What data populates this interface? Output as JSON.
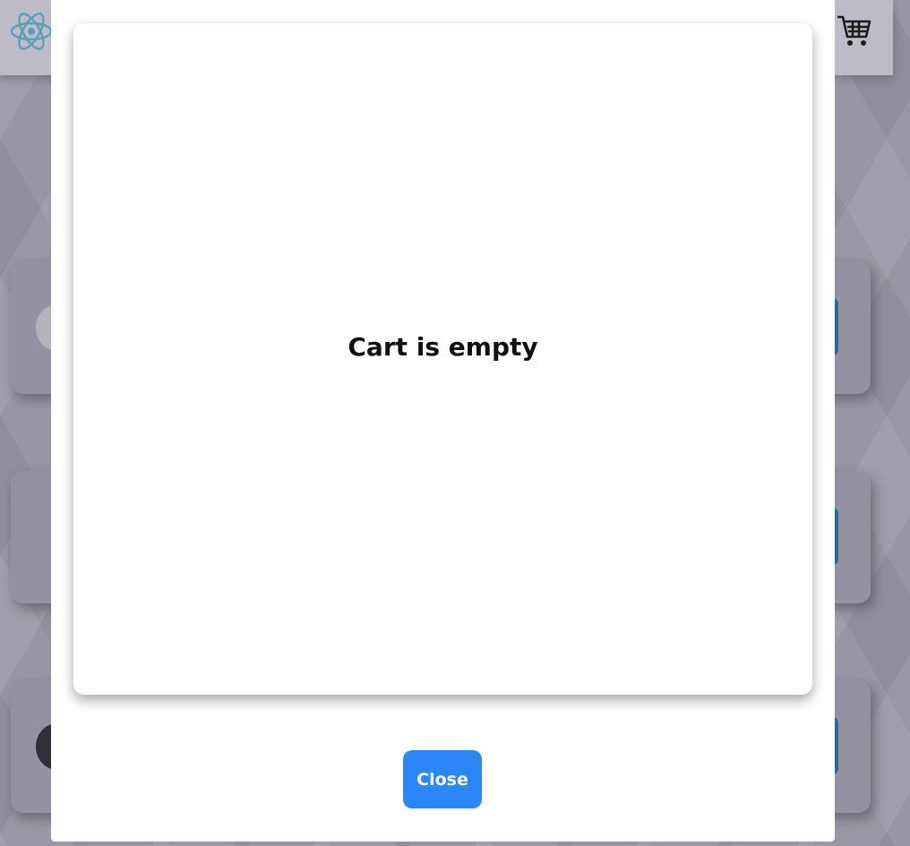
{
  "header": {
    "logo_icon": "react-atom-icon",
    "cart_icon": "shopping-cart-icon",
    "accent_color": "#61b3d6"
  },
  "products": [
    {
      "thumb_color": "#d0d0d4"
    },
    {
      "thumb_color": "#a4a2af"
    },
    {
      "thumb_color": "#2a2a2e"
    }
  ],
  "cart_modal": {
    "empty_message": "Cart is empty",
    "close_label": "Close",
    "close_button_color": "#2b86f7"
  }
}
